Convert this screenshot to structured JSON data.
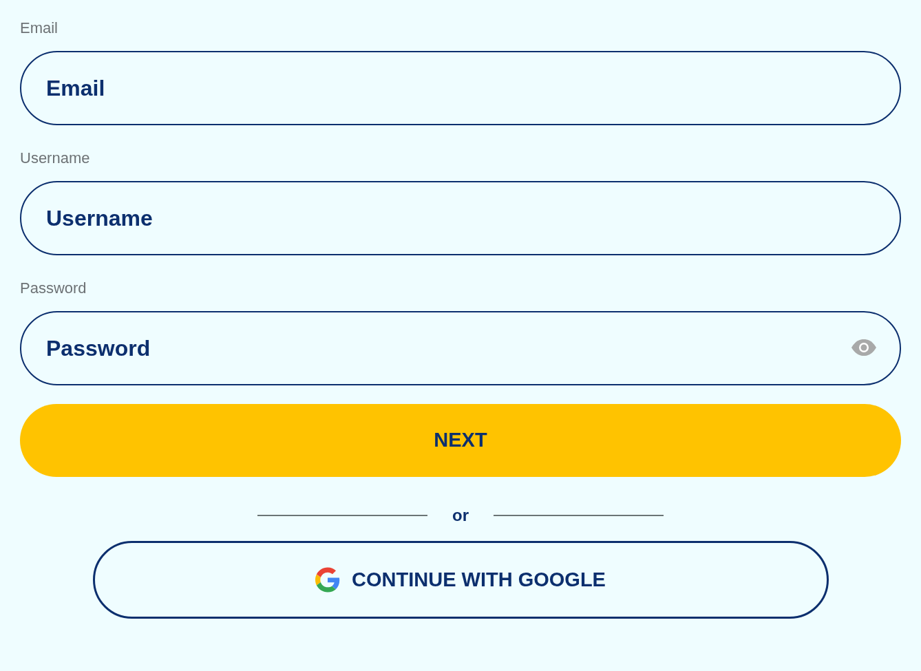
{
  "fields": [
    {
      "kind": "text",
      "label": "Email",
      "placeholder": "Email"
    },
    {
      "kind": "text",
      "label": "Username",
      "placeholder": "Username"
    },
    {
      "kind": "password",
      "label": "Password",
      "placeholder": "Password"
    }
  ],
  "primary_button": {
    "label": "NEXT"
  },
  "divider": {
    "label": "or"
  },
  "google_button": {
    "label": "CONTINUE WITH GOOGLE"
  }
}
